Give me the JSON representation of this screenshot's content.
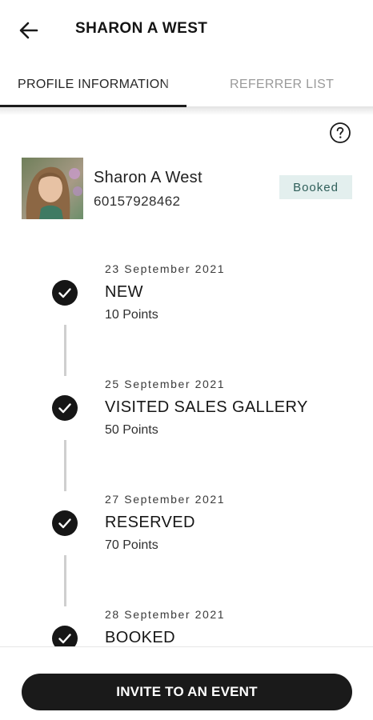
{
  "header": {
    "title": "SHARON A WEST",
    "back_icon": "arrow-left-icon"
  },
  "tabs": [
    {
      "label": "PROFILE INFORMATION",
      "active": true
    },
    {
      "label": "REFERRER LIST",
      "active": false
    }
  ],
  "help": {
    "icon": "help-circle-icon"
  },
  "profile": {
    "name": "Sharon A West",
    "phone": "60157928462",
    "status": "Booked",
    "status_bg": "#e3efee",
    "status_color": "#2f5f5a"
  },
  "timeline": [
    {
      "date": "23 September 2021",
      "status": "NEW",
      "points": "10 Points"
    },
    {
      "date": "25 September 2021",
      "status": "VISITED SALES GALLERY",
      "points": "50 Points"
    },
    {
      "date": "27 September 2021",
      "status": "RESERVED",
      "points": "70 Points"
    },
    {
      "date": "28 September 2021",
      "status": "BOOKED",
      "points": ""
    }
  ],
  "cta": {
    "label": "INVITE TO AN EVENT"
  },
  "colors": {
    "primary": "#1a1a1a",
    "accent_badge": "#e3efee",
    "line": "#cfcfcf"
  }
}
